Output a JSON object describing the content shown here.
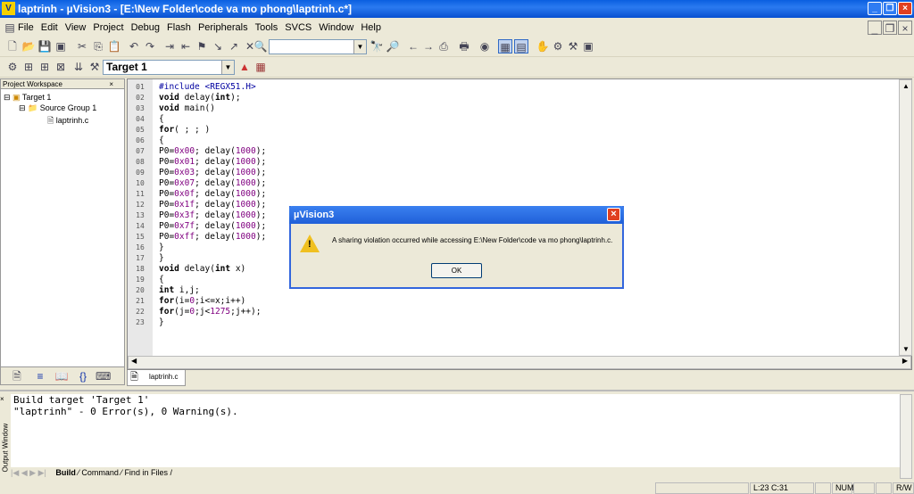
{
  "title": "laptrinh  - µVision3 - [E:\\New Folder\\code va mo phong\\laptrinh.c*]",
  "menu": [
    "File",
    "Edit",
    "View",
    "Project",
    "Debug",
    "Flash",
    "Peripherals",
    "Tools",
    "SVCS",
    "Window",
    "Help"
  ],
  "toolbar": {
    "find_value": "",
    "target": "Target 1"
  },
  "workspace": {
    "header": "Project Workspace",
    "tree": [
      "Target 1",
      "Source Group 1",
      "laptrinh.c"
    ]
  },
  "editor": {
    "tab": "laptrinh.c",
    "lines": [
      [
        [
          "#include <REGX51.H>",
          "pp"
        ]
      ],
      [
        [
          "void",
          "kw"
        ],
        [
          " delay(",
          ""
        ],
        [
          "int",
          "kw"
        ],
        [
          ");",
          ""
        ]
      ],
      [
        [
          "void",
          "kw"
        ],
        [
          " main()",
          ""
        ]
      ],
      [
        [
          "{",
          ""
        ]
      ],
      [
        [
          "for",
          "kw"
        ],
        [
          "( ; ; )",
          ""
        ]
      ],
      [
        [
          "{",
          ""
        ]
      ],
      [
        [
          "P0=",
          ""
        ],
        [
          "0x00",
          "num"
        ],
        [
          "; delay(",
          ""
        ],
        [
          "1000",
          "num"
        ],
        [
          ");",
          ""
        ]
      ],
      [
        [
          "P0=",
          ""
        ],
        [
          "0x01",
          "num"
        ],
        [
          "; delay(",
          ""
        ],
        [
          "1000",
          "num"
        ],
        [
          ");",
          ""
        ]
      ],
      [
        [
          "P0=",
          ""
        ],
        [
          "0x03",
          "num"
        ],
        [
          "; delay(",
          ""
        ],
        [
          "1000",
          "num"
        ],
        [
          ");",
          ""
        ]
      ],
      [
        [
          "P0=",
          ""
        ],
        [
          "0x07",
          "num"
        ],
        [
          "; delay(",
          ""
        ],
        [
          "1000",
          "num"
        ],
        [
          ");",
          ""
        ]
      ],
      [
        [
          "P0=",
          ""
        ],
        [
          "0x0f",
          "num"
        ],
        [
          "; delay(",
          ""
        ],
        [
          "1000",
          "num"
        ],
        [
          ");",
          ""
        ]
      ],
      [
        [
          "P0=",
          ""
        ],
        [
          "0x1f",
          "num"
        ],
        [
          "; delay(",
          ""
        ],
        [
          "1000",
          "num"
        ],
        [
          ");",
          ""
        ]
      ],
      [
        [
          "P0=",
          ""
        ],
        [
          "0x3f",
          "num"
        ],
        [
          "; delay(",
          ""
        ],
        [
          "1000",
          "num"
        ],
        [
          ");",
          ""
        ]
      ],
      [
        [
          "P0=",
          ""
        ],
        [
          "0x7f",
          "num"
        ],
        [
          "; delay(",
          ""
        ],
        [
          "1000",
          "num"
        ],
        [
          ");",
          ""
        ]
      ],
      [
        [
          "P0=",
          ""
        ],
        [
          "0xff",
          "num"
        ],
        [
          "; delay(",
          ""
        ],
        [
          "1000",
          "num"
        ],
        [
          ");",
          ""
        ]
      ],
      [
        [
          "}",
          ""
        ]
      ],
      [
        [
          "}",
          ""
        ]
      ],
      [
        [
          "void",
          "kw"
        ],
        [
          " delay(",
          ""
        ],
        [
          "int",
          "kw"
        ],
        [
          " x)",
          ""
        ]
      ],
      [
        [
          "{",
          ""
        ]
      ],
      [
        [
          "int",
          "kw"
        ],
        [
          " i,j;",
          ""
        ]
      ],
      [
        [
          "for",
          "kw"
        ],
        [
          "(i=",
          ""
        ],
        [
          "0",
          "num"
        ],
        [
          ";i<=x;i++)",
          ""
        ]
      ],
      [
        [
          "for",
          "kw"
        ],
        [
          "(j=",
          ""
        ],
        [
          "0",
          "num"
        ],
        [
          ";j<",
          ""
        ],
        [
          "1275",
          "num"
        ],
        [
          ";j++);",
          ""
        ]
      ],
      [
        [
          "}",
          ""
        ]
      ]
    ]
  },
  "output": {
    "side_label": "Output Window",
    "text": "Build target 'Target 1'\n\"laptrinh\" - 0 Error(s), 0 Warning(s).",
    "tabs": [
      "Build",
      "Command",
      "Find in Files"
    ]
  },
  "status": {
    "pos": "L:23 C:31",
    "num": "NUM",
    "rw": "R/W"
  },
  "dialog": {
    "title": "µVision3",
    "message": "A sharing violation occurred while accessing E:\\New Folder\\code va mo phong\\laptrinh.c.",
    "ok": "OK"
  }
}
